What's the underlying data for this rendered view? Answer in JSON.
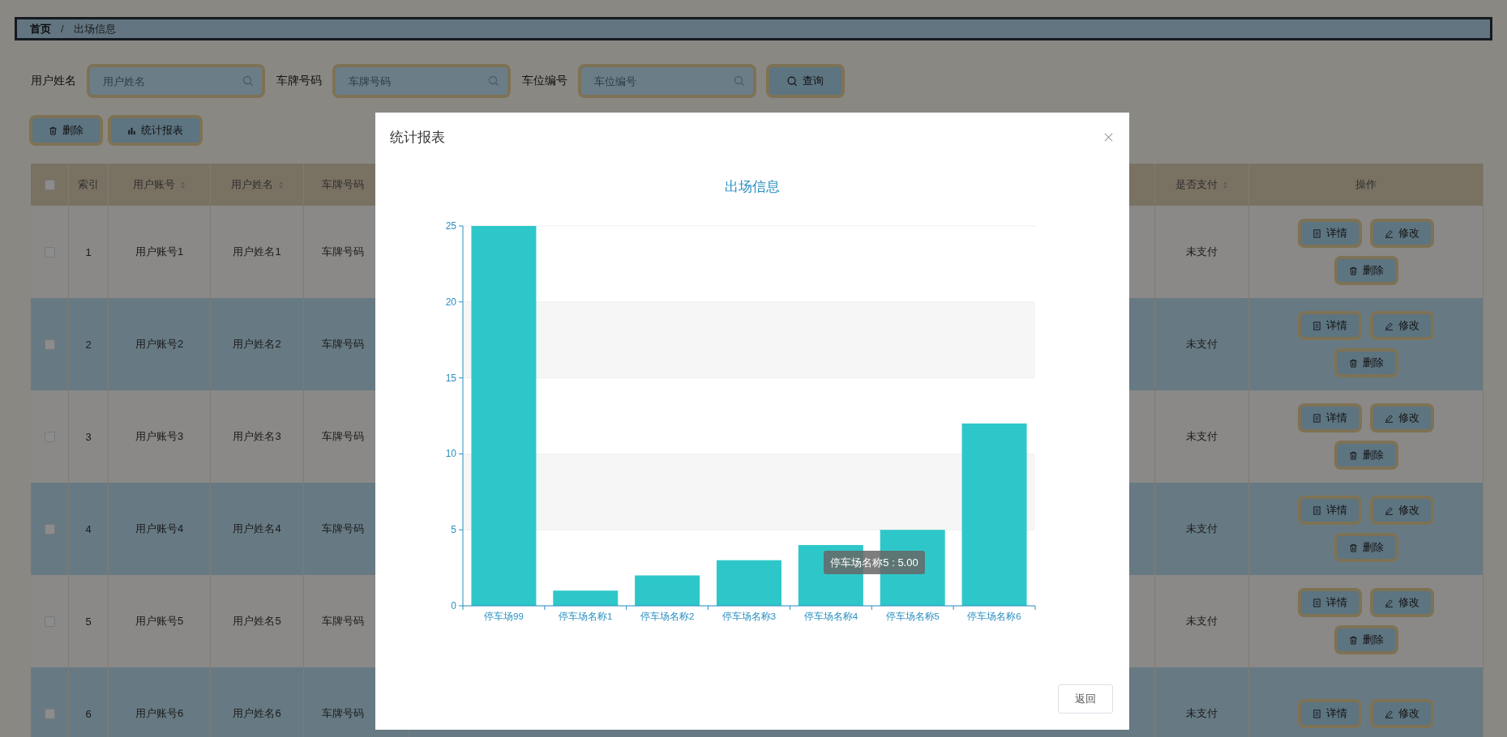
{
  "breadcrumb": {
    "items": [
      {
        "label": "首页",
        "current": false
      },
      {
        "label": "出场信息",
        "current": true
      }
    ],
    "separator": "/"
  },
  "search": {
    "fields": [
      {
        "label": "用户姓名",
        "placeholder": "用户姓名"
      },
      {
        "label": "车牌号码",
        "placeholder": "车牌号码"
      },
      {
        "label": "车位编号",
        "placeholder": "车位编号"
      }
    ],
    "button": "查询"
  },
  "actions": [
    {
      "label": "删除",
      "kind": "delete"
    },
    {
      "label": "统计报表",
      "kind": "chart"
    }
  ],
  "table": {
    "select_all": {
      "checked": false
    },
    "columns": [
      {
        "label": "索引",
        "sortable": false
      },
      {
        "label": "用户账号",
        "sortable": true
      },
      {
        "label": "用户姓名",
        "sortable": true
      },
      {
        "label": "车牌号码",
        "sortable": false
      },
      {
        "label": "是否支付",
        "sortable": true
      },
      {
        "label": "操作",
        "sortable": false
      }
    ],
    "rows": [
      {
        "checked": false,
        "index": "1",
        "account": "用户账号1",
        "name": "用户姓名1",
        "plate": "车牌号码",
        "paid": "未支付",
        "buttons": [
          {
            "label": "详情",
            "kind": "detail"
          },
          {
            "label": "修改",
            "kind": "edit"
          },
          {
            "label": "删除",
            "kind": "delete"
          }
        ]
      },
      {
        "checked": false,
        "index": "2",
        "account": "用户账号2",
        "name": "用户姓名2",
        "plate": "车牌号码",
        "paid": "未支付",
        "buttons": [
          {
            "label": "详情",
            "kind": "detail"
          },
          {
            "label": "修改",
            "kind": "edit"
          },
          {
            "label": "删除",
            "kind": "delete"
          }
        ]
      },
      {
        "checked": false,
        "index": "3",
        "account": "用户账号3",
        "name": "用户姓名3",
        "plate": "车牌号码",
        "paid": "未支付",
        "buttons": [
          {
            "label": "详情",
            "kind": "detail"
          },
          {
            "label": "修改",
            "kind": "edit"
          },
          {
            "label": "删除",
            "kind": "delete"
          }
        ]
      },
      {
        "checked": false,
        "index": "4",
        "account": "用户账号4",
        "name": "用户姓名4",
        "plate": "车牌号码",
        "paid": "未支付",
        "buttons": [
          {
            "label": "详情",
            "kind": "detail"
          },
          {
            "label": "修改",
            "kind": "edit"
          },
          {
            "label": "删除",
            "kind": "delete"
          }
        ]
      },
      {
        "checked": false,
        "index": "5",
        "account": "用户账号5",
        "name": "用户姓名5",
        "plate": "车牌号码",
        "paid": "未支付",
        "buttons": [
          {
            "label": "详情",
            "kind": "detail"
          },
          {
            "label": "修改",
            "kind": "edit"
          },
          {
            "label": "删除",
            "kind": "delete"
          }
        ]
      },
      {
        "checked": false,
        "index": "6",
        "account": "用户账号6",
        "name": "用户姓名6",
        "plate": "车牌号码",
        "paid": "未支付",
        "buttons": [
          {
            "label": "详情",
            "kind": "detail"
          },
          {
            "label": "修改",
            "kind": "edit"
          }
        ]
      }
    ]
  },
  "modal": {
    "title": "统计报表",
    "tooltip": "停车场名称5 : 5.00",
    "chart_data": {
      "type": "bar",
      "title": "出场信息",
      "categories": [
        "停车场99",
        "停车场名称1",
        "停车场名称2",
        "停车场名称3",
        "停车场名称4",
        "停车场名称5",
        "停车场名称6"
      ],
      "series": [
        {
          "color": "#2ec7c9",
          "values": [
            25,
            1,
            2,
            3,
            4,
            5,
            12
          ]
        }
      ],
      "ylim": [
        0,
        25
      ],
      "yticks": [
        0,
        5,
        10,
        15,
        20,
        25
      ],
      "grid": true
    },
    "buttons": [
      "返回"
    ]
  }
}
